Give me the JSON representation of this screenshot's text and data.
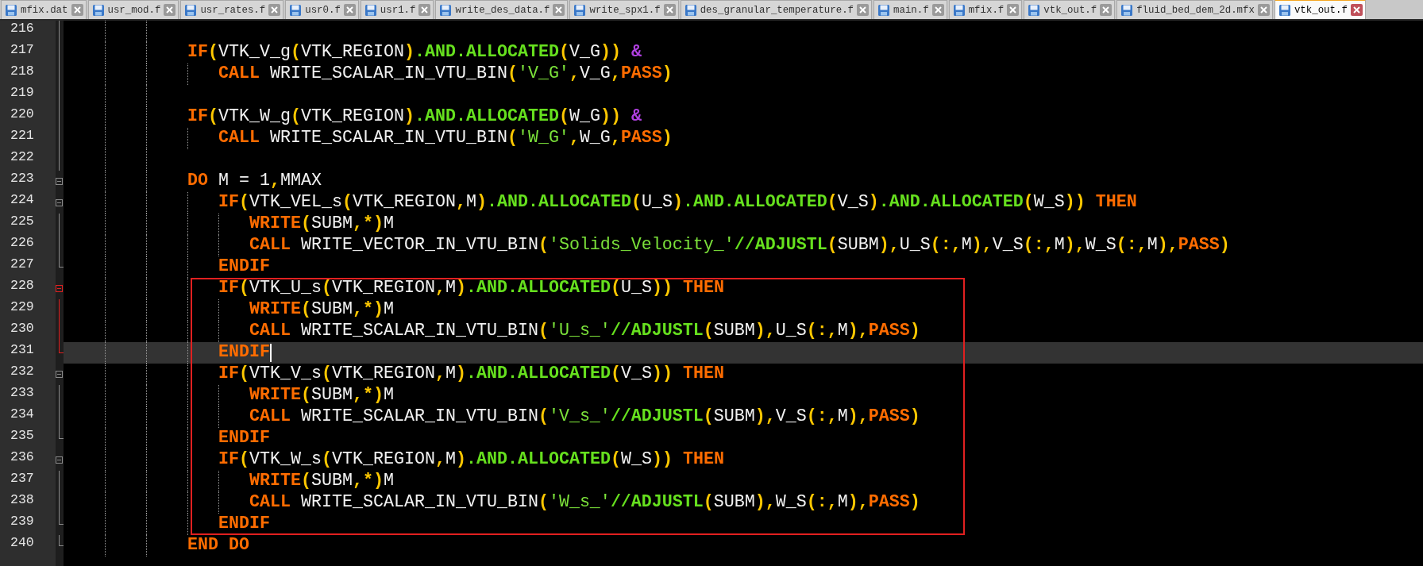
{
  "tabs": [
    {
      "label": "mfix.dat",
      "selected": false
    },
    {
      "label": "usr_mod.f",
      "selected": false
    },
    {
      "label": "usr_rates.f",
      "selected": false
    },
    {
      "label": "usr0.f",
      "selected": false
    },
    {
      "label": "usr1.f",
      "selected": false
    },
    {
      "label": "write_des_data.f",
      "selected": false
    },
    {
      "label": "write_spx1.f",
      "selected": false
    },
    {
      "label": "des_granular_temperature.f",
      "selected": false
    },
    {
      "label": "main.f",
      "selected": false
    },
    {
      "label": "mfix.f",
      "selected": false
    },
    {
      "label": "vtk_out.f",
      "selected": false
    },
    {
      "label": "fluid_bed_dem_2d.mfx",
      "selected": false
    },
    {
      "label": "vtk_out.f",
      "selected": true
    }
  ],
  "editor": {
    "lines": [
      {
        "number": "216",
        "current": false,
        "boxed": false,
        "fold_highlight": false,
        "fold_start": false,
        "fold_end": false
      },
      {
        "number": "217",
        "current": false,
        "boxed": false,
        "fold_highlight": false,
        "fold_start": false,
        "fold_end": false,
        "tokens": [
          {
            "text": "            IF",
            "kind": "keyword"
          },
          {
            "text": "(",
            "kind": "punct"
          },
          {
            "text": "VTK_V_g",
            "kind": "name"
          },
          {
            "text": "(",
            "kind": "punct"
          },
          {
            "text": "VTK_REGION",
            "kind": "name"
          },
          {
            "text": ")",
            "kind": "punct"
          },
          {
            "text": ".AND.ALLOCATED",
            "kind": "intrinsic"
          },
          {
            "text": "(",
            "kind": "punct"
          },
          {
            "text": "V_G",
            "kind": "name"
          },
          {
            "text": "))",
            "kind": "punct"
          },
          {
            "text": " &",
            "kind": "continuation"
          }
        ]
      },
      {
        "number": "218",
        "current": false,
        "boxed": false,
        "fold_highlight": false,
        "fold_start": false,
        "fold_end": false,
        "tokens": [
          {
            "text": "               CALL",
            "kind": "keyword"
          },
          {
            "text": " WRITE_SCALAR_IN_VTU_BIN",
            "kind": "name"
          },
          {
            "text": "(",
            "kind": "punct"
          },
          {
            "text": "'V_G'",
            "kind": "string"
          },
          {
            "text": ",",
            "kind": "punct"
          },
          {
            "text": "V_G",
            "kind": "name"
          },
          {
            "text": ",",
            "kind": "punct"
          },
          {
            "text": "PASS",
            "kind": "keyword"
          },
          {
            "text": ")",
            "kind": "punct"
          }
        ]
      },
      {
        "number": "219",
        "current": false,
        "boxed": false,
        "fold_highlight": false,
        "fold_start": false,
        "fold_end": false
      },
      {
        "number": "220",
        "current": false,
        "boxed": false,
        "fold_highlight": false,
        "fold_start": false,
        "fold_end": false,
        "tokens": [
          {
            "text": "            IF",
            "kind": "keyword"
          },
          {
            "text": "(",
            "kind": "punct"
          },
          {
            "text": "VTK_W_g",
            "kind": "name"
          },
          {
            "text": "(",
            "kind": "punct"
          },
          {
            "text": "VTK_REGION",
            "kind": "name"
          },
          {
            "text": ")",
            "kind": "punct"
          },
          {
            "text": ".AND.ALLOCATED",
            "kind": "intrinsic"
          },
          {
            "text": "(",
            "kind": "punct"
          },
          {
            "text": "W_G",
            "kind": "name"
          },
          {
            "text": "))",
            "kind": "punct"
          },
          {
            "text": " &",
            "kind": "continuation"
          }
        ]
      },
      {
        "number": "221",
        "current": false,
        "boxed": false,
        "fold_highlight": false,
        "fold_start": false,
        "fold_end": false,
        "tokens": [
          {
            "text": "               CALL",
            "kind": "keyword"
          },
          {
            "text": " WRITE_SCALAR_IN_VTU_BIN",
            "kind": "name"
          },
          {
            "text": "(",
            "kind": "punct"
          },
          {
            "text": "'W_G'",
            "kind": "string"
          },
          {
            "text": ",",
            "kind": "punct"
          },
          {
            "text": "W_G",
            "kind": "name"
          },
          {
            "text": ",",
            "kind": "punct"
          },
          {
            "text": "PASS",
            "kind": "keyword"
          },
          {
            "text": ")",
            "kind": "punct"
          }
        ]
      },
      {
        "number": "222",
        "current": false,
        "boxed": false,
        "fold_highlight": false,
        "fold_start": false,
        "fold_end": false
      },
      {
        "number": "223",
        "current": false,
        "boxed": false,
        "fold_highlight": false,
        "fold_start": true,
        "fold_end": false,
        "tokens": [
          {
            "text": "            DO",
            "kind": "keyword"
          },
          {
            "text": " M = 1",
            "kind": "name"
          },
          {
            "text": ",",
            "kind": "punct"
          },
          {
            "text": "MMAX",
            "kind": "name"
          }
        ]
      },
      {
        "number": "224",
        "current": false,
        "boxed": false,
        "fold_highlight": false,
        "fold_start": true,
        "fold_end": false,
        "tokens": [
          {
            "text": "               IF",
            "kind": "keyword"
          },
          {
            "text": "(",
            "kind": "punct"
          },
          {
            "text": "VTK_VEL_s",
            "kind": "name"
          },
          {
            "text": "(",
            "kind": "punct"
          },
          {
            "text": "VTK_REGION",
            "kind": "name"
          },
          {
            "text": ",",
            "kind": "punct"
          },
          {
            "text": "M",
            "kind": "name"
          },
          {
            "text": ")",
            "kind": "punct"
          },
          {
            "text": ".AND.ALLOCATED",
            "kind": "intrinsic"
          },
          {
            "text": "(",
            "kind": "punct"
          },
          {
            "text": "U_S",
            "kind": "name"
          },
          {
            "text": ")",
            "kind": "punct"
          },
          {
            "text": ".AND.ALLOCATED",
            "kind": "intrinsic"
          },
          {
            "text": "(",
            "kind": "punct"
          },
          {
            "text": "V_S",
            "kind": "name"
          },
          {
            "text": ")",
            "kind": "punct"
          },
          {
            "text": ".AND.ALLOCATED",
            "kind": "intrinsic"
          },
          {
            "text": "(",
            "kind": "punct"
          },
          {
            "text": "W_S",
            "kind": "name"
          },
          {
            "text": "))",
            "kind": "punct"
          },
          {
            "text": " THEN",
            "kind": "keyword"
          }
        ]
      },
      {
        "number": "225",
        "current": false,
        "boxed": false,
        "fold_highlight": false,
        "fold_start": false,
        "fold_end": false,
        "tokens": [
          {
            "text": "                  WRITE",
            "kind": "keyword"
          },
          {
            "text": "(",
            "kind": "punct"
          },
          {
            "text": "SUBM",
            "kind": "name"
          },
          {
            "text": ",*)",
            "kind": "punct"
          },
          {
            "text": "M",
            "kind": "name"
          }
        ]
      },
      {
        "number": "226",
        "current": false,
        "boxed": false,
        "fold_highlight": false,
        "fold_start": false,
        "fold_end": false,
        "tokens": [
          {
            "text": "                  CALL",
            "kind": "keyword"
          },
          {
            "text": " WRITE_VECTOR_IN_VTU_BIN",
            "kind": "name"
          },
          {
            "text": "(",
            "kind": "punct"
          },
          {
            "text": "'Solids_Velocity_'",
            "kind": "string"
          },
          {
            "text": "//ADJUSTL",
            "kind": "intrinsic"
          },
          {
            "text": "(",
            "kind": "punct"
          },
          {
            "text": "SUBM",
            "kind": "name"
          },
          {
            "text": "),",
            "kind": "punct"
          },
          {
            "text": "U_S",
            "kind": "name"
          },
          {
            "text": "(:,",
            "kind": "punct"
          },
          {
            "text": "M",
            "kind": "name"
          },
          {
            "text": "),",
            "kind": "punct"
          },
          {
            "text": "V_S",
            "kind": "name"
          },
          {
            "text": "(:,",
            "kind": "punct"
          },
          {
            "text": "M",
            "kind": "name"
          },
          {
            "text": "),",
            "kind": "punct"
          },
          {
            "text": "W_S",
            "kind": "name"
          },
          {
            "text": "(:,",
            "kind": "punct"
          },
          {
            "text": "M",
            "kind": "name"
          },
          {
            "text": "),",
            "kind": "punct"
          },
          {
            "text": "PASS",
            "kind": "keyword"
          },
          {
            "text": ")",
            "kind": "punct"
          }
        ]
      },
      {
        "number": "227",
        "current": false,
        "boxed": false,
        "fold_highlight": false,
        "fold_start": false,
        "fold_end": true,
        "tokens": [
          {
            "text": "               ENDIF",
            "kind": "keyword"
          }
        ]
      },
      {
        "number": "228",
        "current": false,
        "boxed": true,
        "fold_highlight": true,
        "fold_start": true,
        "fold_end": false,
        "tokens": [
          {
            "text": "               IF",
            "kind": "keyword"
          },
          {
            "text": "(",
            "kind": "punct"
          },
          {
            "text": "VTK_U_s",
            "kind": "name"
          },
          {
            "text": "(",
            "kind": "punct"
          },
          {
            "text": "VTK_REGION",
            "kind": "name"
          },
          {
            "text": ",",
            "kind": "punct"
          },
          {
            "text": "M",
            "kind": "name"
          },
          {
            "text": ")",
            "kind": "punct"
          },
          {
            "text": ".AND.ALLOCATED",
            "kind": "intrinsic"
          },
          {
            "text": "(",
            "kind": "punct"
          },
          {
            "text": "U_S",
            "kind": "name"
          },
          {
            "text": "))",
            "kind": "punct"
          },
          {
            "text": " THEN",
            "kind": "keyword"
          }
        ]
      },
      {
        "number": "229",
        "current": false,
        "boxed": true,
        "fold_highlight": true,
        "fold_start": false,
        "fold_end": false,
        "tokens": [
          {
            "text": "                  WRITE",
            "kind": "keyword"
          },
          {
            "text": "(",
            "kind": "punct"
          },
          {
            "text": "SUBM",
            "kind": "name"
          },
          {
            "text": ",*)",
            "kind": "punct"
          },
          {
            "text": "M",
            "kind": "name"
          }
        ]
      },
      {
        "number": "230",
        "current": false,
        "boxed": true,
        "fold_highlight": true,
        "fold_start": false,
        "fold_end": false,
        "tokens": [
          {
            "text": "                  CALL",
            "kind": "keyword"
          },
          {
            "text": " WRITE_SCALAR_IN_VTU_BIN",
            "kind": "name"
          },
          {
            "text": "(",
            "kind": "punct"
          },
          {
            "text": "'U_s_'",
            "kind": "string"
          },
          {
            "text": "//ADJUSTL",
            "kind": "intrinsic"
          },
          {
            "text": "(",
            "kind": "punct"
          },
          {
            "text": "SUBM",
            "kind": "name"
          },
          {
            "text": "),",
            "kind": "punct"
          },
          {
            "text": "U_S",
            "kind": "name"
          },
          {
            "text": "(:,",
            "kind": "punct"
          },
          {
            "text": "M",
            "kind": "name"
          },
          {
            "text": "),",
            "kind": "punct"
          },
          {
            "text": "PASS",
            "kind": "keyword"
          },
          {
            "text": ")",
            "kind": "punct"
          }
        ]
      },
      {
        "number": "231",
        "current": true,
        "boxed": true,
        "fold_highlight": true,
        "fold_start": false,
        "fold_end": true,
        "tokens": [
          {
            "text": "               ENDIF",
            "kind": "keyword"
          }
        ]
      },
      {
        "number": "232",
        "current": false,
        "boxed": true,
        "fold_highlight": false,
        "fold_start": true,
        "fold_end": false,
        "tokens": [
          {
            "text": "               IF",
            "kind": "keyword"
          },
          {
            "text": "(",
            "kind": "punct"
          },
          {
            "text": "VTK_V_s",
            "kind": "name"
          },
          {
            "text": "(",
            "kind": "punct"
          },
          {
            "text": "VTK_REGION",
            "kind": "name"
          },
          {
            "text": ",",
            "kind": "punct"
          },
          {
            "text": "M",
            "kind": "name"
          },
          {
            "text": ")",
            "kind": "punct"
          },
          {
            "text": ".AND.ALLOCATED",
            "kind": "intrinsic"
          },
          {
            "text": "(",
            "kind": "punct"
          },
          {
            "text": "V_S",
            "kind": "name"
          },
          {
            "text": "))",
            "kind": "punct"
          },
          {
            "text": " THEN",
            "kind": "keyword"
          }
        ]
      },
      {
        "number": "233",
        "current": false,
        "boxed": true,
        "fold_highlight": false,
        "fold_start": false,
        "fold_end": false,
        "tokens": [
          {
            "text": "                  WRITE",
            "kind": "keyword"
          },
          {
            "text": "(",
            "kind": "punct"
          },
          {
            "text": "SUBM",
            "kind": "name"
          },
          {
            "text": ",*)",
            "kind": "punct"
          },
          {
            "text": "M",
            "kind": "name"
          }
        ]
      },
      {
        "number": "234",
        "current": false,
        "boxed": true,
        "fold_highlight": false,
        "fold_start": false,
        "fold_end": false,
        "tokens": [
          {
            "text": "                  CALL",
            "kind": "keyword"
          },
          {
            "text": " WRITE_SCALAR_IN_VTU_BIN",
            "kind": "name"
          },
          {
            "text": "(",
            "kind": "punct"
          },
          {
            "text": "'V_s_'",
            "kind": "string"
          },
          {
            "text": "//ADJUSTL",
            "kind": "intrinsic"
          },
          {
            "text": "(",
            "kind": "punct"
          },
          {
            "text": "SUBM",
            "kind": "name"
          },
          {
            "text": "),",
            "kind": "punct"
          },
          {
            "text": "V_S",
            "kind": "name"
          },
          {
            "text": "(:,",
            "kind": "punct"
          },
          {
            "text": "M",
            "kind": "name"
          },
          {
            "text": "),",
            "kind": "punct"
          },
          {
            "text": "PASS",
            "kind": "keyword"
          },
          {
            "text": ")",
            "kind": "punct"
          }
        ]
      },
      {
        "number": "235",
        "current": false,
        "boxed": true,
        "fold_highlight": false,
        "fold_start": false,
        "fold_end": true,
        "tokens": [
          {
            "text": "               ENDIF",
            "kind": "keyword"
          }
        ]
      },
      {
        "number": "236",
        "current": false,
        "boxed": true,
        "fold_highlight": false,
        "fold_start": true,
        "fold_end": false,
        "tokens": [
          {
            "text": "               IF",
            "kind": "keyword"
          },
          {
            "text": "(",
            "kind": "punct"
          },
          {
            "text": "VTK_W_s",
            "kind": "name"
          },
          {
            "text": "(",
            "kind": "punct"
          },
          {
            "text": "VTK_REGION",
            "kind": "name"
          },
          {
            "text": ",",
            "kind": "punct"
          },
          {
            "text": "M",
            "kind": "name"
          },
          {
            "text": ")",
            "kind": "punct"
          },
          {
            "text": ".AND.ALLOCATED",
            "kind": "intrinsic"
          },
          {
            "text": "(",
            "kind": "punct"
          },
          {
            "text": "W_S",
            "kind": "name"
          },
          {
            "text": "))",
            "kind": "punct"
          },
          {
            "text": " THEN",
            "kind": "keyword"
          }
        ]
      },
      {
        "number": "237",
        "current": false,
        "boxed": true,
        "fold_highlight": false,
        "fold_start": false,
        "fold_end": false,
        "tokens": [
          {
            "text": "                  WRITE",
            "kind": "keyword"
          },
          {
            "text": "(",
            "kind": "punct"
          },
          {
            "text": "SUBM",
            "kind": "name"
          },
          {
            "text": ",*)",
            "kind": "punct"
          },
          {
            "text": "M",
            "kind": "name"
          }
        ]
      },
      {
        "number": "238",
        "current": false,
        "boxed": true,
        "fold_highlight": false,
        "fold_start": false,
        "fold_end": false,
        "tokens": [
          {
            "text": "                  CALL",
            "kind": "keyword"
          },
          {
            "text": " WRITE_SCALAR_IN_VTU_BIN",
            "kind": "name"
          },
          {
            "text": "(",
            "kind": "punct"
          },
          {
            "text": "'W_s_'",
            "kind": "string"
          },
          {
            "text": "//ADJUSTL",
            "kind": "intrinsic"
          },
          {
            "text": "(",
            "kind": "punct"
          },
          {
            "text": "SUBM",
            "kind": "name"
          },
          {
            "text": "),",
            "kind": "punct"
          },
          {
            "text": "W_S",
            "kind": "name"
          },
          {
            "text": "(:,",
            "kind": "punct"
          },
          {
            "text": "M",
            "kind": "name"
          },
          {
            "text": "),",
            "kind": "punct"
          },
          {
            "text": "PASS",
            "kind": "keyword"
          },
          {
            "text": ")",
            "kind": "punct"
          }
        ]
      },
      {
        "number": "239",
        "current": false,
        "boxed": true,
        "fold_highlight": false,
        "fold_start": false,
        "fold_end": true,
        "tokens": [
          {
            "text": "               ENDIF",
            "kind": "keyword"
          }
        ]
      },
      {
        "number": "240",
        "current": false,
        "boxed": false,
        "fold_highlight": false,
        "fold_start": false,
        "fold_end": true,
        "tokens": [
          {
            "text": "            END DO",
            "kind": "keyword"
          }
        ]
      }
    ]
  }
}
